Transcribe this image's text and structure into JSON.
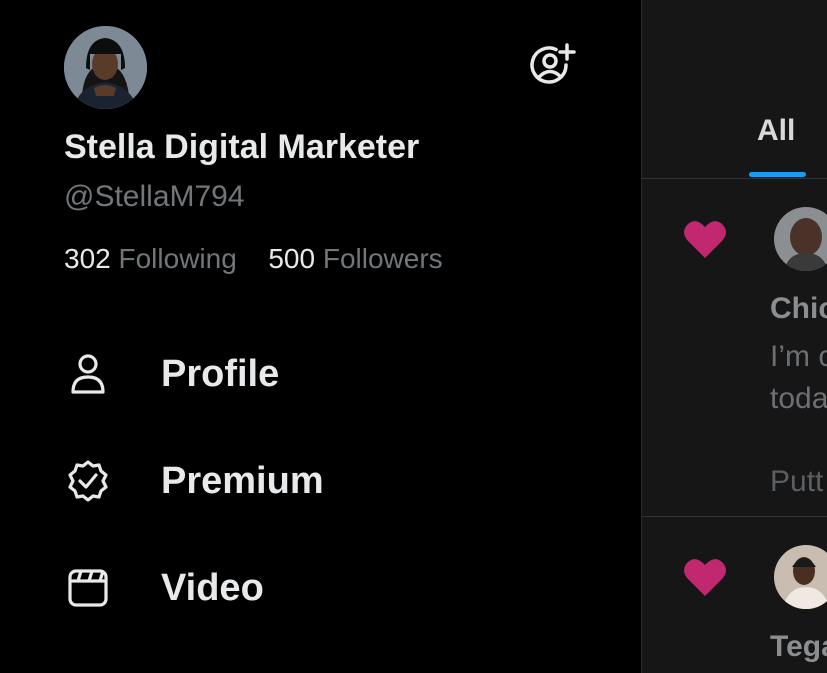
{
  "profile": {
    "display_name": "Stella Digital Marketer",
    "handle": "@StellaM794",
    "following_count": "302",
    "following_label": "Following",
    "followers_count": "500",
    "followers_label": "Followers"
  },
  "menu": {
    "items": [
      {
        "label": "Profile",
        "icon": "person-icon"
      },
      {
        "label": "Premium",
        "icon": "verified-badge-icon"
      },
      {
        "label": "Video",
        "icon": "video-clapper-icon"
      }
    ]
  },
  "notifications": {
    "tabs": [
      {
        "label": "All",
        "selected": true
      }
    ],
    "items": [
      {
        "name": "Chic",
        "body_line1": "I’m c",
        "body_line2": "toda",
        "footer": "Putt"
      },
      {
        "name": "Tega"
      }
    ]
  },
  "colors": {
    "background": "#000000",
    "text_primary": "#e7e9ea",
    "text_secondary": "#71767b",
    "accent_blue": "#1d9bf0",
    "heart": "#c1286f"
  }
}
